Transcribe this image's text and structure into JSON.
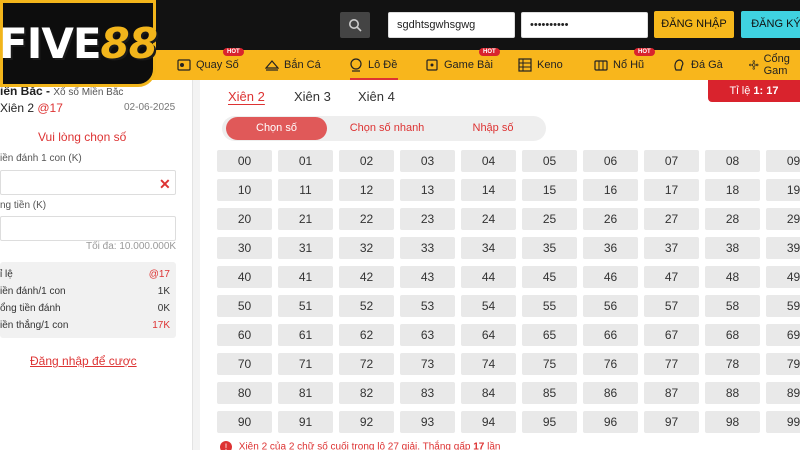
{
  "header": {
    "logo_text": "FIVE",
    "logo_num": "88",
    "username_value": "sgdhtsgwhsgwg",
    "password_value": "••••••••••",
    "login_label": "ĐĂNG NHẬP",
    "register_label": "ĐĂNG KÝ"
  },
  "nav": {
    "hot_badge": "HOT",
    "items": [
      {
        "label": "Quay Số",
        "icon": "lottery-ball-icon"
      },
      {
        "label": "Bắn Cá",
        "icon": "fish-icon"
      },
      {
        "label": "Lô Đề",
        "icon": "dice-icon"
      },
      {
        "label": "Game Bài",
        "icon": "cards-icon"
      },
      {
        "label": "Keno",
        "icon": "keno-icon"
      },
      {
        "label": "Nổ Hũ",
        "icon": "slot-icon"
      },
      {
        "label": "Đá Gà",
        "icon": "rooster-icon"
      },
      {
        "label": "Cổng Gam",
        "icon": "gamepad-icon"
      }
    ]
  },
  "left": {
    "title": "iền Bắc -",
    "subtitle": "Xổ số Miền Bắc",
    "xien_label": "Xiên 2",
    "xien_rate": "@17",
    "date": "02-06-2025",
    "choose_prompt": "Vui lòng chọn số",
    "amount_label": "iền đánh 1 con (K)",
    "total_label": "ng tiền (K)",
    "max_text": "Tối đa: 10.000.000K",
    "rows": [
      {
        "k": "ỉ lệ",
        "v": "@17"
      },
      {
        "k": "iền đánh/1 con",
        "v": "1K"
      },
      {
        "k": "ổng tiền đánh",
        "v": "0K"
      },
      {
        "k": "iền thắng/1 con",
        "v": "17K"
      }
    ],
    "login_link": "Đăng nhập để cược"
  },
  "main": {
    "tabs": [
      "Xiên 2",
      "Xiên 3",
      "Xiên 4"
    ],
    "rate_prefix": "Tỉ lệ",
    "rate_value": "1: 17",
    "segments": [
      "Chọn số",
      "Chọn số nhanh",
      "Nhập số"
    ],
    "footer_text": "Xiên 2 của 2 chữ số cuối trong lô 27 giải. Thắng gấp",
    "footer_mult": "17",
    "footer_tail": "lần"
  },
  "numbers": [
    "00",
    "01",
    "02",
    "03",
    "04",
    "05",
    "06",
    "07",
    "08",
    "09",
    "10",
    "11",
    "12",
    "13",
    "14",
    "15",
    "16",
    "17",
    "18",
    "19",
    "20",
    "21",
    "22",
    "23",
    "24",
    "25",
    "26",
    "27",
    "28",
    "29",
    "30",
    "31",
    "32",
    "33",
    "34",
    "35",
    "36",
    "37",
    "38",
    "39",
    "40",
    "41",
    "42",
    "43",
    "44",
    "45",
    "46",
    "47",
    "48",
    "49",
    "50",
    "51",
    "52",
    "53",
    "54",
    "55",
    "56",
    "57",
    "58",
    "59",
    "60",
    "61",
    "62",
    "63",
    "64",
    "65",
    "66",
    "67",
    "68",
    "69",
    "70",
    "71",
    "72",
    "73",
    "74",
    "75",
    "76",
    "77",
    "78",
    "79",
    "80",
    "81",
    "82",
    "83",
    "84",
    "85",
    "86",
    "87",
    "88",
    "89",
    "90",
    "91",
    "92",
    "93",
    "94",
    "95",
    "96",
    "97",
    "98",
    "99"
  ],
  "colors": {
    "accent": "#f8b61c",
    "red": "#d9232d",
    "cyan": "#3fd2e1"
  }
}
